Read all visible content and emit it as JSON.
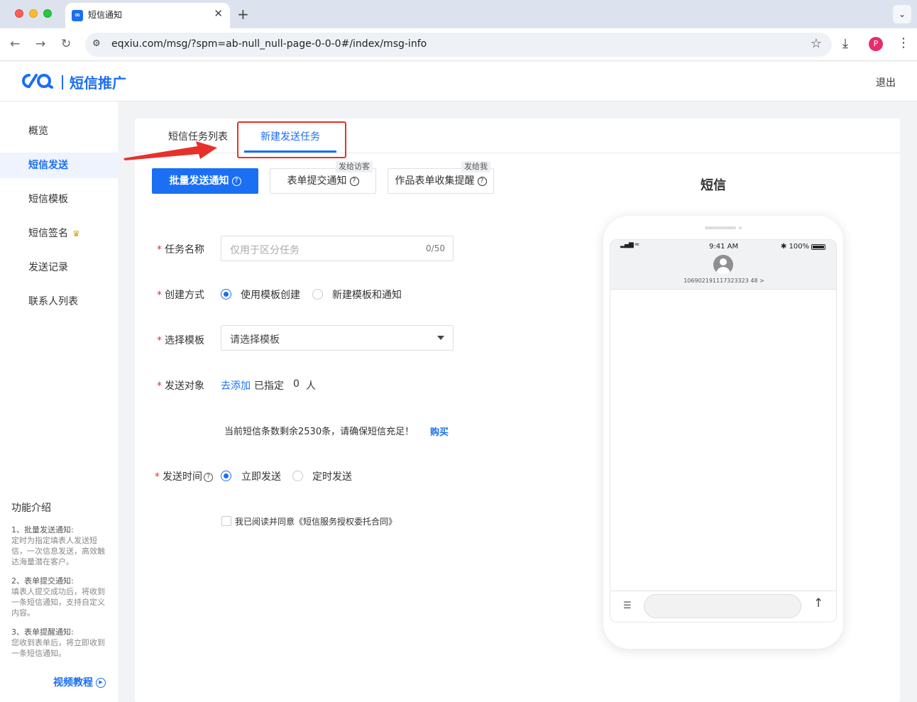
{
  "browser": {
    "tab_title": "短信通知",
    "tab_favicon": "∞",
    "url": "eqxiu.com/msg/?spm=ab-null_null-page-0-0-0#/index/msg-info",
    "profile_initial": "P"
  },
  "header": {
    "brand_text": "短信推广",
    "logout_label": "退出"
  },
  "sidebar": {
    "items": [
      {
        "label": "概览"
      },
      {
        "label": "短信发送"
      },
      {
        "label": "短信模板"
      },
      {
        "label": "短信签名"
      },
      {
        "label": "发送记录"
      },
      {
        "label": "联系人列表"
      }
    ],
    "intro_title": "功能介绍",
    "intro_items": [
      {
        "title": "1、批量发送通知:",
        "desc": "定时为指定填表人发送短信，一次信息发送，高效触达海量潜在客户。"
      },
      {
        "title": "2、表单提交通知:",
        "desc": "填表人提交成功后，将收到一条短信通知，支持自定义内容。"
      },
      {
        "title": "3、表单提醒通知:",
        "desc": "您收到表单后，将立即收到一条短信通知。"
      }
    ],
    "video_label": "视频教程"
  },
  "tabs": {
    "list_label": "短信任务列表",
    "new_label": "新建发送任务"
  },
  "type_buttons": {
    "batch_label": "批量发送通知",
    "form_label": "表单提交通知",
    "form_badge": "发给访客",
    "collect_label": "作品表单收集提醒",
    "collect_badge": "发给我"
  },
  "form": {
    "task_name_label": "任务名称",
    "task_name_placeholder": "仅用于区分任务",
    "task_name_count": "0/50",
    "create_method_label": "创建方式",
    "create_option_template": "使用模板创建",
    "create_option_new": "新建模板和通知",
    "template_label": "选择模板",
    "template_placeholder": "请选择模板",
    "target_label": "发送对象",
    "add_link": "去添加",
    "assigned_text": "已指定",
    "assigned_count": "0",
    "assigned_unit": "人",
    "remaining_text": "当前短信条数剩余2530条，请确保短信充足！",
    "buy_link": "购买",
    "send_time_label": "发送时间",
    "send_now": "立即发送",
    "send_scheduled": "定时发送",
    "agreement": "我已阅读并同意《短信服务授权委托合同》"
  },
  "preview": {
    "title": "短信",
    "time": "9:41 AM",
    "battery": "100%",
    "sender": "106902191117323323 48 >"
  },
  "colors": {
    "brand": "#1a6ff3",
    "required": "#e8302a",
    "highlight": "#e8302a"
  }
}
